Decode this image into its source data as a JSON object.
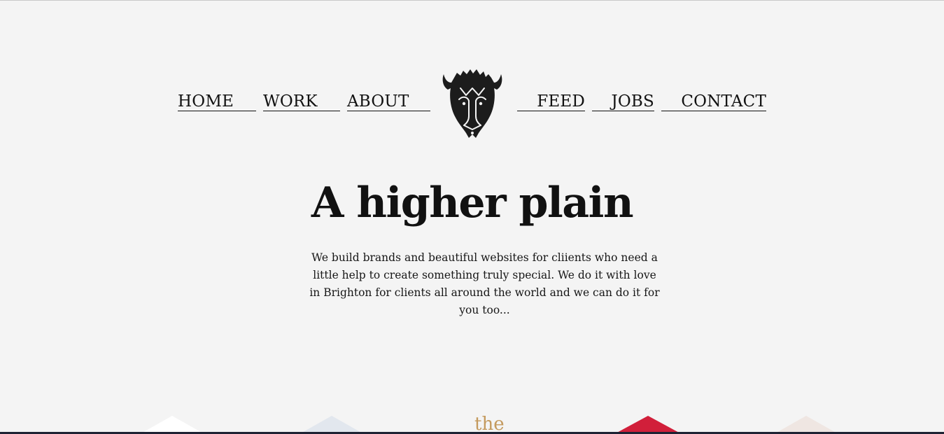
{
  "nav": {
    "home": "HOME",
    "work": "WORK",
    "about": "ABOUT",
    "feed": "FEED",
    "jobs": "JOBS",
    "contact": "CONTACT"
  },
  "logo": {
    "icon": "bison-head-icon"
  },
  "hero": {
    "title": "A higher plain",
    "intro": "We build brands and beautiful websites for cliients who need a little help to create something truly special. We do it with love in Brighton for clients all around the world and we can do it for you too..."
  },
  "tiles": {
    "third_text": "the"
  },
  "colors": {
    "background": "#f4f4f4",
    "text": "#111111",
    "accent_red": "#d11f3a",
    "tile_gold": "#c49a5e"
  }
}
